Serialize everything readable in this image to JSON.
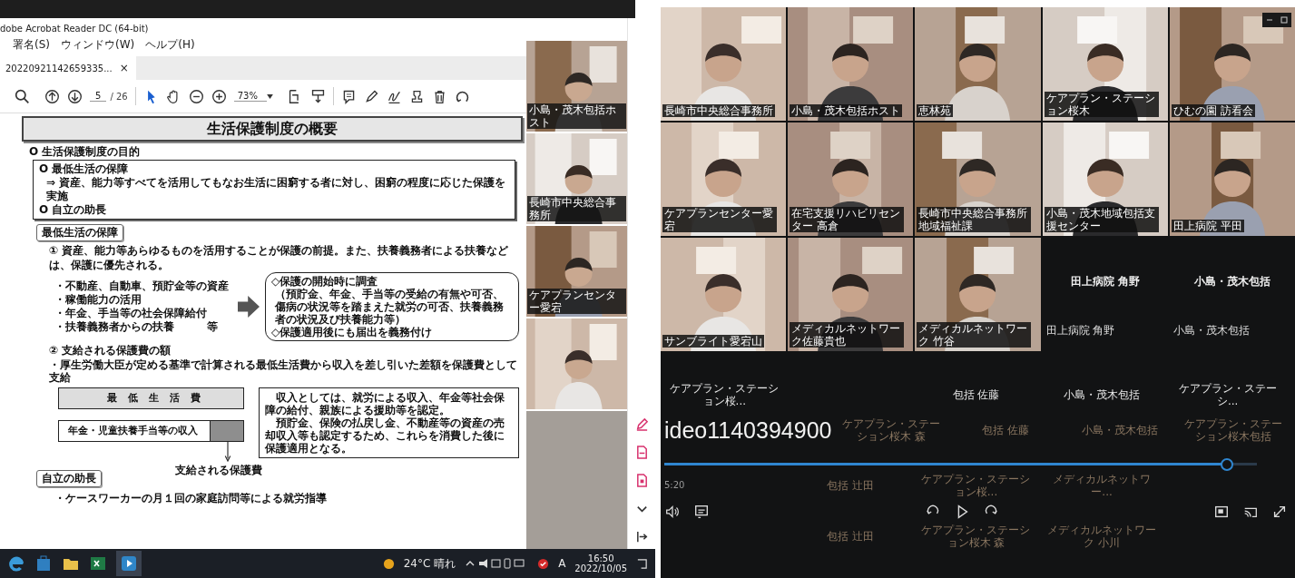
{
  "reader": {
    "app_title": "dobe Acrobat Reader DC (64-bit)",
    "menu": [
      "署名(S)",
      "ウィンドウ(W)",
      "ヘルプ(H)"
    ],
    "tab": {
      "label": "20220921142659335...",
      "close": "×"
    },
    "page": "5",
    "page_total": "/ 26",
    "zoom": "73%",
    "document": {
      "title": "生活保護制度の概要",
      "purpose_heading": "O 生活保護制度の目的",
      "purpose": [
        "O 最低生活の保障",
        "⇒ 資産、能力等すべてを活用してもなお生活に困窮する者に対し、困窮の程度に応じた保護を実施",
        "O 自立の助長"
      ],
      "tag_minimum": "最低生活の保障",
      "point_1": "① 資産、能力等あらゆるものを活用することが保護の前提。また、扶養義務者による扶養などは、保護に優先される。",
      "assets": [
        "・不動産、自動車、預貯金等の資産",
        "・稼働能力の活用",
        "・年金、手当等の社会保障給付",
        "・扶養義務者からの扶養　　　等"
      ],
      "check_box": [
        "◇保護の開始時に調査",
        "（預貯金、年金、手当等の受給の有無や可否、傷病の状況等を踏まえた就労の可否、扶養義務者の状況及び扶養能力等）",
        "◇保護適用後にも届出を義務付け"
      ],
      "point_2": "② 支給される保護費の額",
      "point_2_text": "・厚生労働大臣が定める基準で計算される最低生活費から収入を差し引いた差額を保護費として支給",
      "bar_minimum": "最 低 生 活 費",
      "bar_income": "年金・児童扶養手当等の収入",
      "benefit_label": "支給される保護費",
      "income_note": [
        "収入としては、就労による収入、年金等社会保障の給付、親族による援助等を認定。",
        "預貯金、保険の払戻し金、不動産等の資産の売却収入等も認定するため、これらを消費した後に保護適用となる。"
      ],
      "tag_independence": "自立の助長",
      "last_line": "・ケースワーカーの月１回の家庭訪問等による就労指導"
    }
  },
  "side_videos": [
    {
      "kind": "video",
      "name": "小島・茂木包括ホスト"
    },
    {
      "kind": "video",
      "name": "長崎市中央総合事務所"
    },
    {
      "kind": "video",
      "name": "ケアプランセンター愛宕"
    },
    {
      "kind": "video"
    }
  ],
  "taskbar": {
    "weather": "24°C 晴れ",
    "ime": "A",
    "time": "16:50",
    "date": "2022/10/05"
  },
  "meeting": {
    "tiles": [
      {
        "kind": "video",
        "name": "長崎市中央総合事務所"
      },
      {
        "kind": "video",
        "name": "小島・茂木包括ホスト"
      },
      {
        "kind": "video",
        "name": "恵林苑"
      },
      {
        "kind": "video",
        "name": "ケアプラン・ステーション桜木"
      },
      {
        "kind": "video",
        "name": "ひむの園 訪看会"
      },
      {
        "kind": "video",
        "name": "ケアプランセンター愛宕"
      },
      {
        "kind": "video",
        "name": "在宅支援リハビリセンター 高倉"
      },
      {
        "kind": "video",
        "name": "長崎市中央総合事務所地域福祉課"
      },
      {
        "kind": "video",
        "name": "小島・茂木地域包括支援センター"
      },
      {
        "kind": "video",
        "name": "田上病院 平田"
      },
      {
        "kind": "video",
        "name": "サンブライト愛宕山"
      },
      {
        "kind": "video",
        "name": "メディカルネットワーク佐藤貴也"
      },
      {
        "kind": "video",
        "name": "メディカルネットワーク 竹谷"
      },
      {
        "kind": "name_only",
        "title": "田上病院 角野",
        "name": "田上病院 角野"
      },
      {
        "kind": "name_only",
        "title": "小島・茂木包括",
        "name": "小島・茂木包括"
      }
    ],
    "rows": [
      {
        "cells": [
          {
            "kind": "bright",
            "text": "ケアプラン・ステーション桜..."
          },
          {
            "kind": "empty"
          },
          {
            "kind": "bright",
            "text": "包括 佐藤"
          },
          {
            "kind": "bright",
            "text": "小島・茂木包括"
          },
          {
            "kind": "bright",
            "text": "ケアプラン・ステーシ..."
          }
        ]
      },
      {
        "cells": [
          {
            "kind": "title",
            "text": "ideo1140394900"
          },
          {
            "kind": "faint",
            "text": "ケアプラン・ステーション桜木 森"
          },
          {
            "kind": "faint",
            "text": "包括 佐藤"
          },
          {
            "kind": "faint",
            "text": "小島・茂木包括"
          },
          {
            "kind": "faint",
            "text": "ケアプラン・ステーション桜木包括"
          }
        ]
      }
    ],
    "progress": {
      "level": 0.95
    },
    "under_rows": [
      {
        "cells": [
          {
            "kind": "time",
            "text": "5:20"
          },
          {
            "kind": "faint",
            "text": "包括 辻田"
          },
          {
            "kind": "faint",
            "text": "ケアプラン・ステーション桜..."
          },
          {
            "kind": "faint",
            "text": "メディカルネットワー..."
          },
          {
            "kind": "empty"
          }
        ]
      }
    ],
    "bottom_row": {
      "cells": [
        {
          "kind": "empty"
        },
        {
          "kind": "faint",
          "text": "包括 辻田"
        },
        {
          "kind": "faint",
          "text": "ケアプラン・ステーション桜木 森"
        },
        {
          "kind": "faint",
          "text": "メディカルネットワーク 小川"
        },
        {
          "kind": "empty"
        }
      ]
    }
  }
}
